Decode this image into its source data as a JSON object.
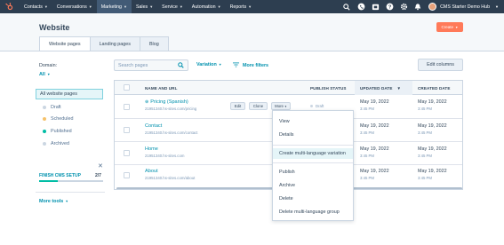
{
  "nav": {
    "items": [
      {
        "label": "Contacts",
        "active": false
      },
      {
        "label": "Conversations",
        "active": false
      },
      {
        "label": "Marketing",
        "active": true
      },
      {
        "label": "Sales",
        "active": false
      },
      {
        "label": "Service",
        "active": false
      },
      {
        "label": "Automation",
        "active": false
      },
      {
        "label": "Reports",
        "active": false
      }
    ],
    "account": "CMS Starter Demo Hub",
    "colors": {
      "bar": "#2d3e50",
      "active": "#425b76",
      "brand": "#ff7a59"
    }
  },
  "header": {
    "title": "Website",
    "create_label": "Create",
    "tabs": [
      "Website pages",
      "Landing pages",
      "Blog"
    ]
  },
  "sidebar": {
    "domain_label": "Domain:",
    "domain_value": "All",
    "all_label": "All website pages",
    "items": [
      {
        "label": "Draft",
        "color": "#cbd6e2"
      },
      {
        "label": "Scheduled",
        "color": "#f5c26b"
      },
      {
        "label": "Published",
        "color": "#00bda5"
      },
      {
        "label": "Archived",
        "color": "#cbd6e2"
      }
    ],
    "setup_label": "FINISH CMS SETUP",
    "setup_count": "2/7",
    "setup_progress": 0.2857,
    "more_tools": "More tools"
  },
  "toolbar": {
    "search_placeholder": "Search pages",
    "variation": "Variation",
    "more_filters": "More filters",
    "edit_columns": "Edit columns"
  },
  "table": {
    "columns": [
      "NAME AND URL",
      "PUBLISH STATUS",
      "UPDATED DATE",
      "CREATED DATE"
    ],
    "rows": [
      {
        "name": "Pricing (Spanish)",
        "url": "21951340.hs-sites.com/pricing",
        "status": "Draft",
        "updated_date": "May 19, 2022",
        "updated_time": "3:45 PM",
        "created_date": "May 19, 2022",
        "created_time": "3:45 PM"
      },
      {
        "name": "Contact",
        "url": "21951340.hs-sites.com/contact",
        "status": "",
        "updated_date": "May 19, 2022",
        "updated_time": "3:45 PM",
        "created_date": "May 19, 2022",
        "created_time": "3:45 PM"
      },
      {
        "name": "Home",
        "url": "21951340.hs-sites.com",
        "status": "",
        "updated_date": "May 19, 2022",
        "updated_time": "3:45 PM",
        "created_date": "May 19, 2022",
        "created_time": "3:45 PM"
      },
      {
        "name": "About",
        "url": "21951340.hs-sites.com/about",
        "status": "",
        "updated_date": "May 19, 2022",
        "updated_time": "3:45 PM",
        "created_date": "May 19, 2022",
        "created_time": "3:45 PM"
      }
    ],
    "row_buttons": {
      "edit": "Edit",
      "clone": "Clone",
      "more": "More"
    }
  },
  "dropdown": {
    "items": [
      "View",
      "Details",
      "Create multi-language variation",
      "Publish",
      "Archive",
      "Delete",
      "Delete multi-language group"
    ],
    "hovered": "Create multi-language variation"
  }
}
